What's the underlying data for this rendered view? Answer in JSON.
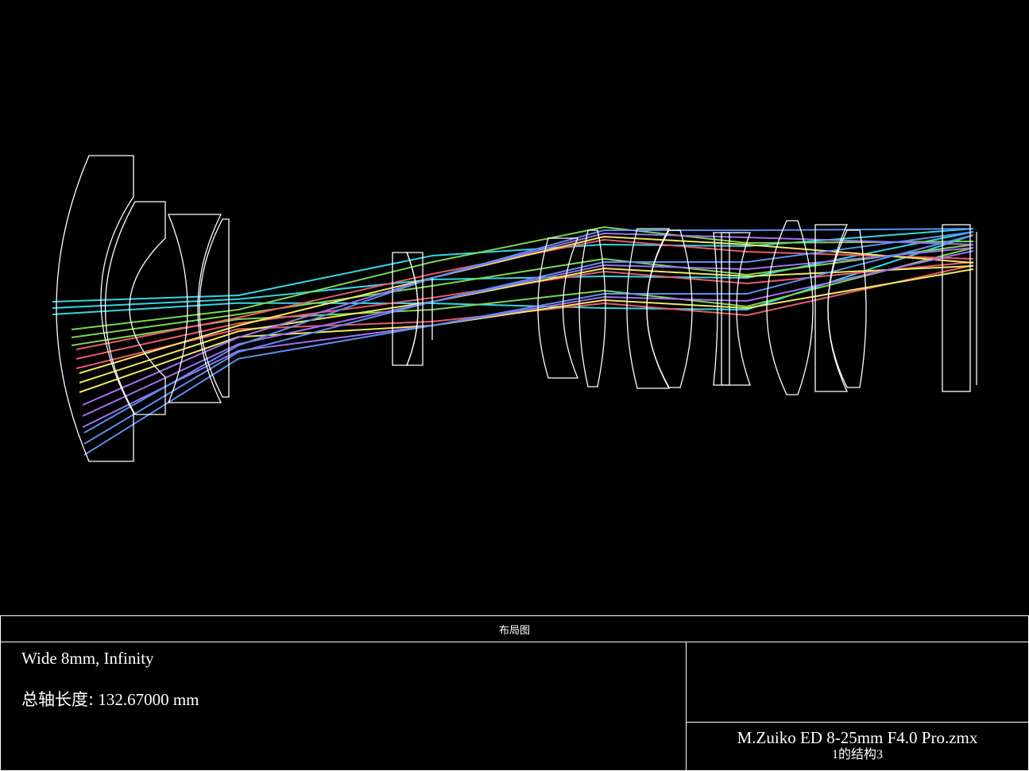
{
  "footer": {
    "panel_title": "布局图",
    "configuration": "Wide 8mm, Infinity",
    "axial_length_label": "总轴长度:",
    "axial_length_value": "132.67000 mm",
    "file_name": "M.Zuiko ED 8-25mm F4.0 Pro.zmx",
    "configuration_index": "1的结构3"
  },
  "colors": {
    "background": "#000000",
    "lens_outline": "#ffffff",
    "ray_fields": [
      "#33d6e6",
      "#7ad653",
      "#e85a6a",
      "#f0e860",
      "#a070f0",
      "#5a90f0"
    ]
  }
}
